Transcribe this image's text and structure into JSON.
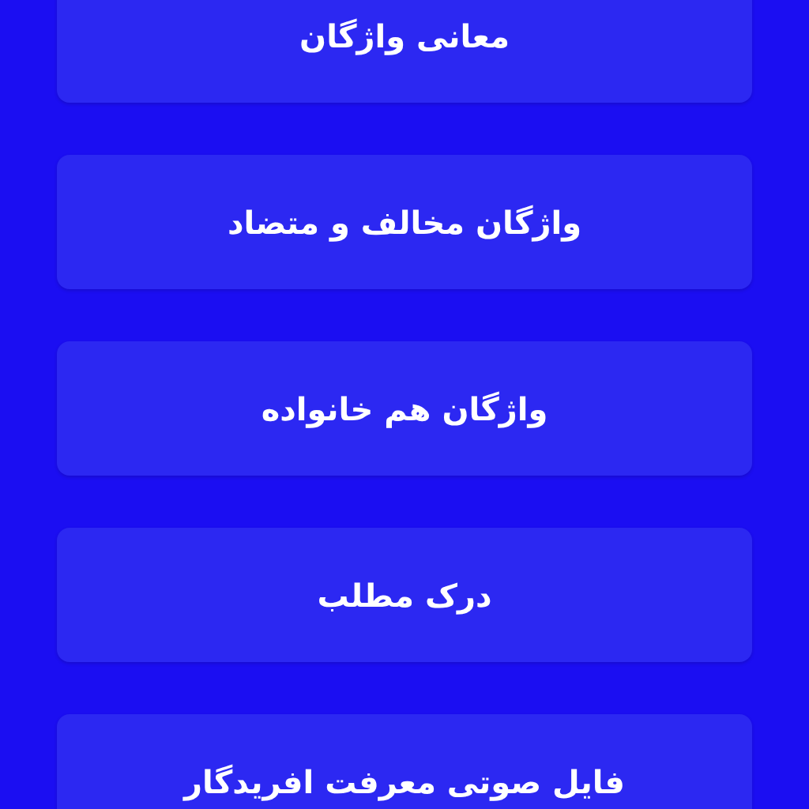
{
  "menu_items": [
    {
      "label": "معانی واژگان"
    },
    {
      "label": "واژگان مخالف و متضاد"
    },
    {
      "label": "واژگان هم خانواده"
    },
    {
      "label": "درک مطلب"
    },
    {
      "label": "فایل صوتی معرفت افریدگار"
    }
  ]
}
